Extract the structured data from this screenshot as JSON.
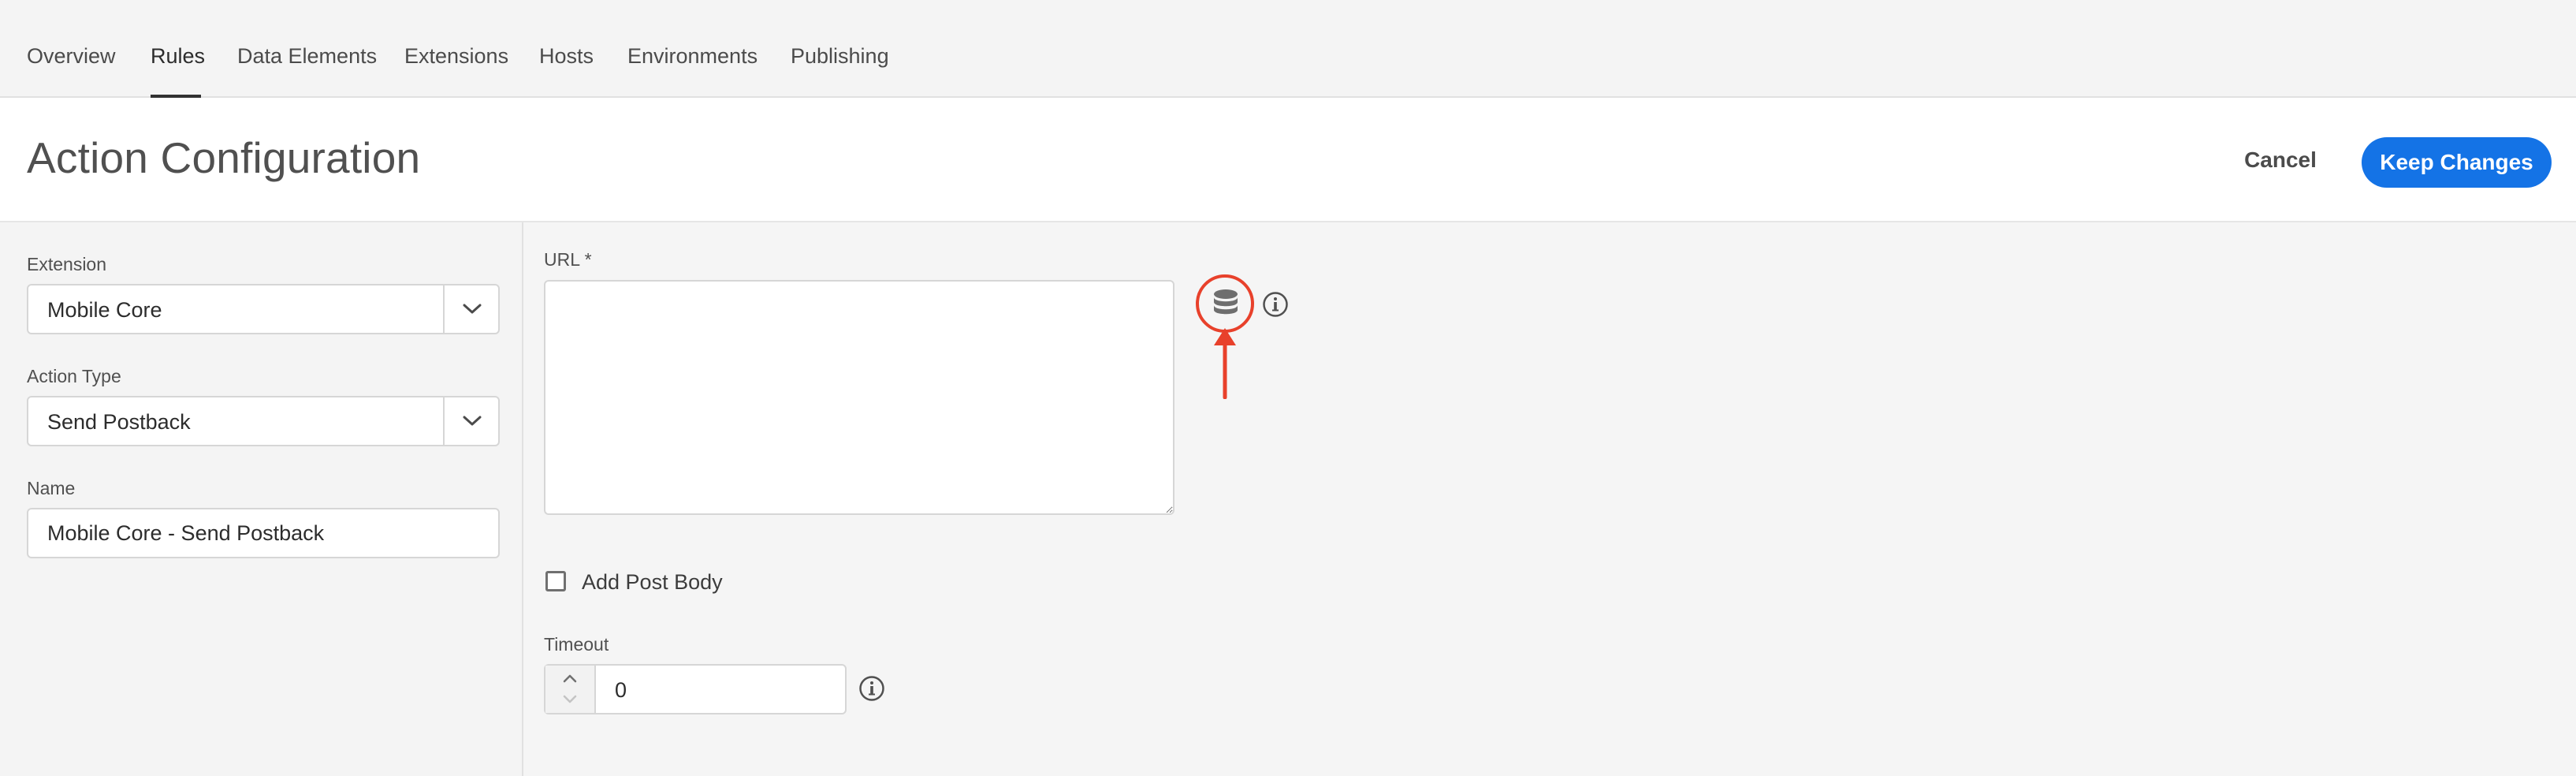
{
  "nav": {
    "tabs": [
      {
        "label": "Overview"
      },
      {
        "label": "Rules"
      },
      {
        "label": "Data Elements"
      },
      {
        "label": "Extensions"
      },
      {
        "label": "Hosts"
      },
      {
        "label": "Environments"
      },
      {
        "label": "Publishing"
      }
    ],
    "active_tab": "Rules"
  },
  "header": {
    "title": "Action Configuration",
    "cancel_label": "Cancel",
    "keep_label": "Keep Changes"
  },
  "left": {
    "extension": {
      "label": "Extension",
      "value": "Mobile Core"
    },
    "action_type": {
      "label": "Action Type",
      "value": "Send Postback"
    },
    "name": {
      "label": "Name",
      "value": "Mobile Core - Send Postback"
    }
  },
  "config": {
    "url": {
      "label": "URL",
      "required_mark": "*",
      "value": ""
    },
    "post_body": {
      "label": "Add Post Body",
      "checked": false
    },
    "timeout": {
      "label": "Timeout",
      "value": "0"
    }
  },
  "icons": {
    "data_element": "database-icon",
    "info": "info-icon",
    "dropdown": "chevron-down-icon",
    "stepper_up": "chevron-up-icon",
    "stepper_down": "chevron-down-icon"
  },
  "colors": {
    "accent": "#1473e6",
    "annotation": "#e8412b"
  }
}
